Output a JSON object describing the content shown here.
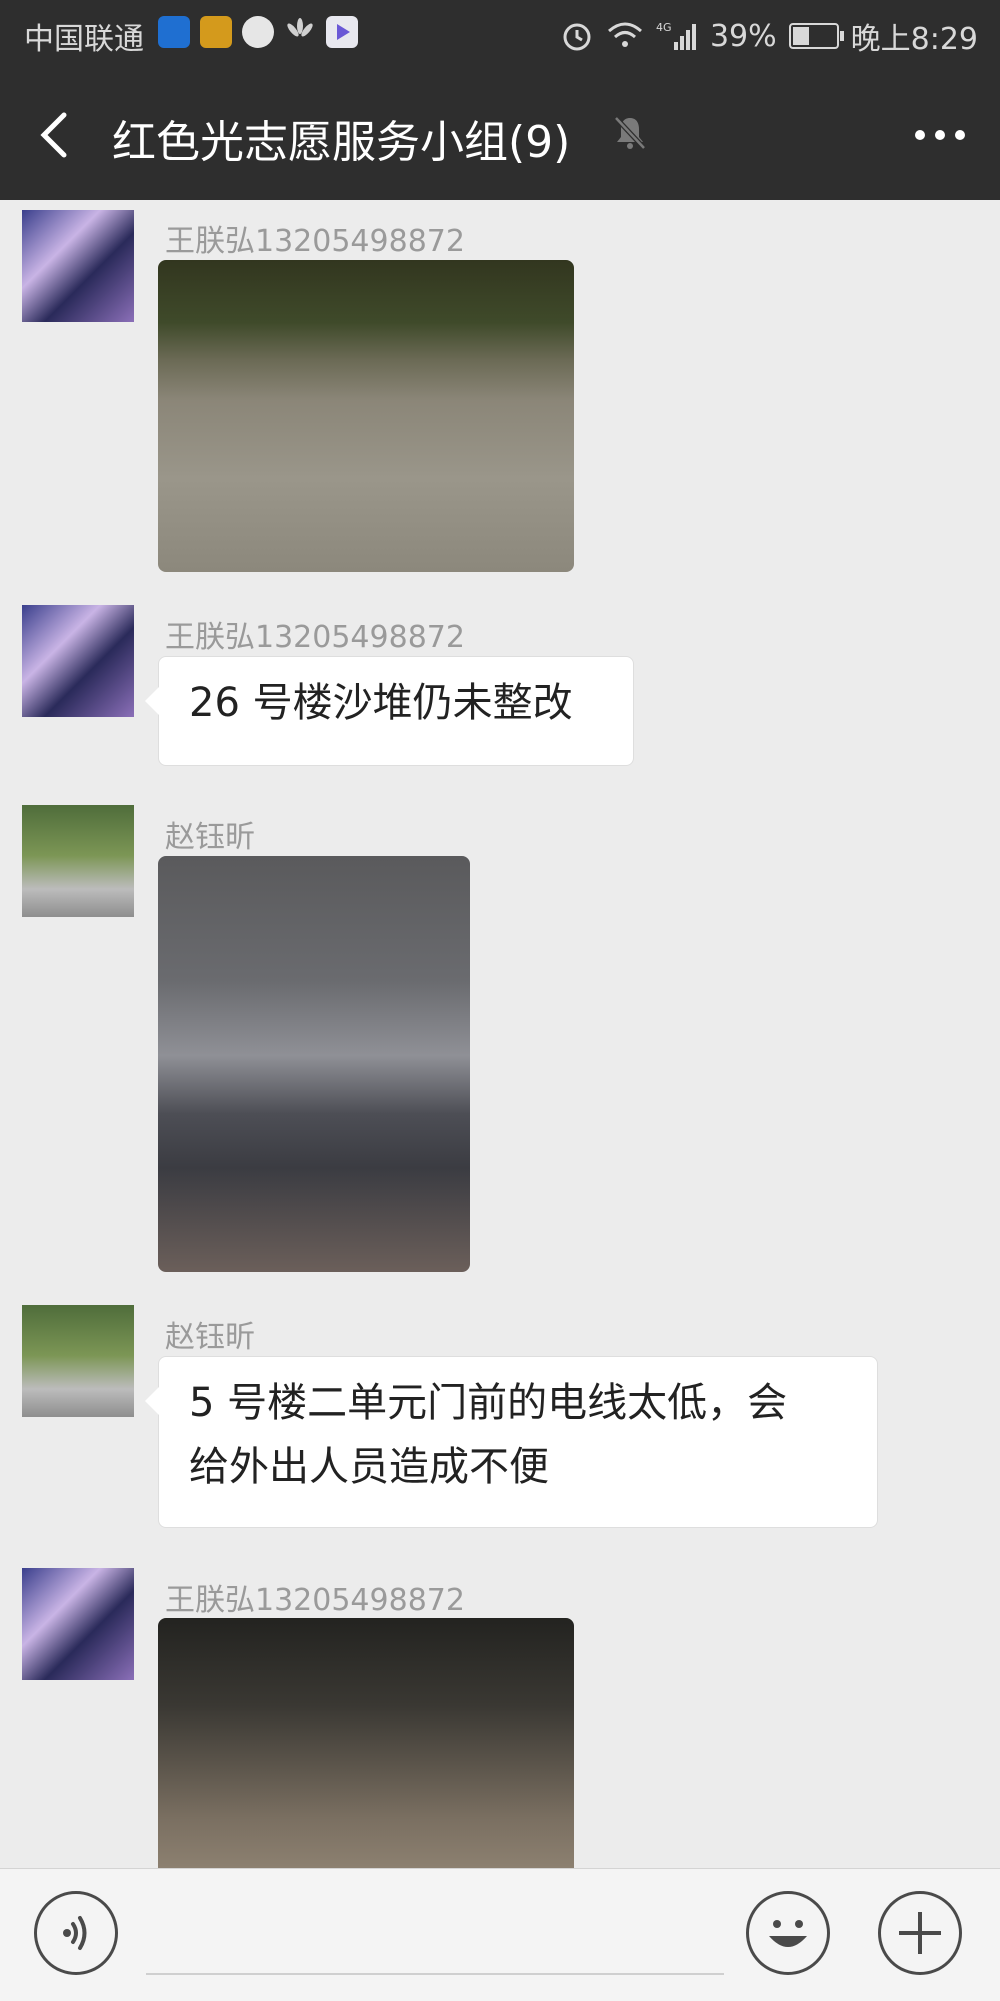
{
  "status_bar": {
    "carrier": "中国联通",
    "app_icons": [
      "shield-icon",
      "news-icon",
      "browser-icon",
      "huawei-icon",
      "video-icon"
    ],
    "battery": "39%",
    "battery_level": 0.39,
    "time": "晚上8:29"
  },
  "header": {
    "title": "红色光志愿服务小组(9)"
  },
  "messages": [
    {
      "sender": "王朕弘13205498872",
      "type": "image",
      "avatar": "anime-avatar"
    },
    {
      "sender": "王朕弘13205498872",
      "type": "text",
      "avatar": "anime-avatar",
      "text": "26 号楼沙堆仍未整改"
    },
    {
      "sender": "赵钰昕",
      "type": "image",
      "avatar": "umbrella-avatar"
    },
    {
      "sender": "赵钰昕",
      "type": "text",
      "avatar": "umbrella-avatar",
      "lines": [
        "5 号楼二单元门前的电线太低，会",
        "给外出人员造成不便"
      ]
    },
    {
      "sender": "王朕弘13205498872",
      "type": "image",
      "avatar": "anime-avatar"
    }
  ],
  "input_bar": {
    "placeholder": ""
  },
  "colors": {
    "header_bg": "#2e2e2e",
    "chat_bg": "#ececec",
    "bubble_bg": "#ffffff",
    "sender_text": "#9a9a9a"
  }
}
